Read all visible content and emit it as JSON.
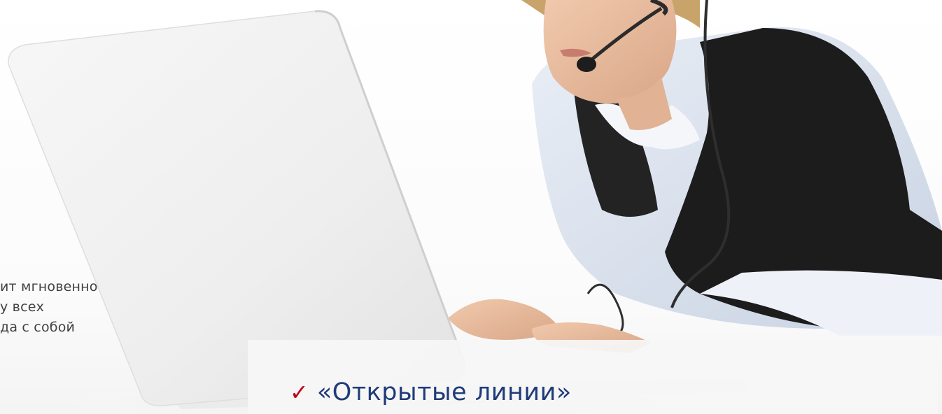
{
  "side_text": {
    "line1": "ит мгновенно",
    "line2": "у всех",
    "line3": "да с собой"
  },
  "caption": {
    "check_icon": "✓",
    "text": "«Открытые линии»"
  },
  "photo": {
    "icon": "operator-with-headset-and-laptop-image"
  },
  "colors": {
    "check": "#c0001a",
    "caption_text": "#1f3b78",
    "body_text": "#404040",
    "panel": "#f6f6f6"
  }
}
